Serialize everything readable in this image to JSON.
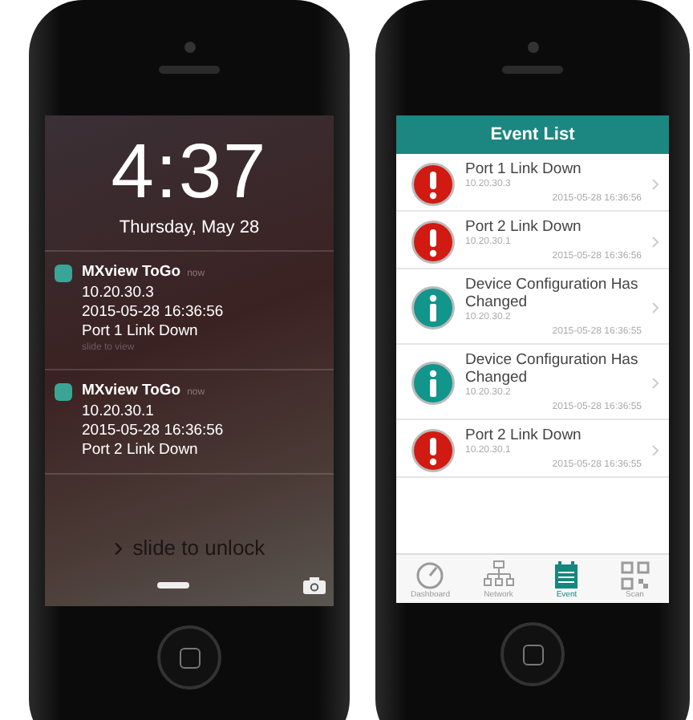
{
  "lock_screen": {
    "time": "4:37",
    "date": "Thursday, May 28",
    "notifications": [
      {
        "app": "MXview ToGo",
        "age": "now",
        "lines": [
          "10.20.30.3",
          "2015-05-28 16:36:56",
          "Port 1 Link Down"
        ],
        "hint": "slide to view"
      },
      {
        "app": "MXview ToGo",
        "age": "now",
        "lines": [
          "10.20.30.1",
          "2015-05-28 16:36:56",
          "Port 2 Link Down"
        ]
      }
    ],
    "unlock": {
      "arrow": "›",
      "label": "slide to unlock"
    }
  },
  "event_list": {
    "title": "Event List",
    "events": [
      {
        "kind": "error",
        "title": "Port 1 Link Down",
        "address": "10.20.30.3",
        "time": "2015-05-28 16:36:56"
      },
      {
        "kind": "error",
        "title": "Port 2 Link Down",
        "address": "10.20.30.1",
        "time": "2015-05-28 16:36:56"
      },
      {
        "kind": "info",
        "title": "Device Configuration Has Changed",
        "address": "10.20.30.2",
        "time": "2015-05-28 16:36:55"
      },
      {
        "kind": "info",
        "title": "Device Configuration Has Changed",
        "address": "10.20.30.2",
        "time": "2015-05-28 16:36:55"
      },
      {
        "kind": "error",
        "title": "Port 2 Link Down",
        "address": "10.20.30.1",
        "time": "2015-05-28 16:36:55"
      }
    ],
    "tabs": [
      {
        "kind": "dashboard",
        "label": "Dashboard",
        "selected": false
      },
      {
        "kind": "network",
        "label": "Network",
        "selected": false
      },
      {
        "kind": "event",
        "label": "Event",
        "selected": true
      },
      {
        "kind": "scan",
        "label": "Scan",
        "selected": false
      }
    ]
  }
}
